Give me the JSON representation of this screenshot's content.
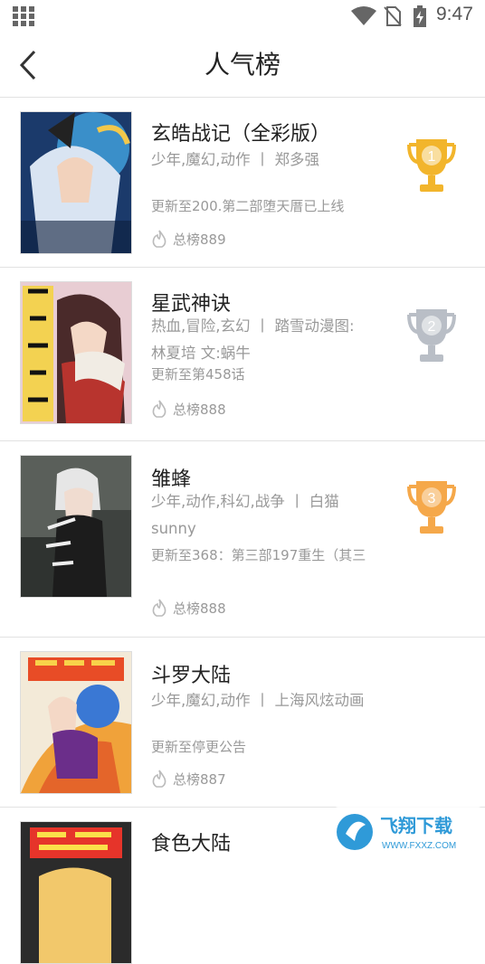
{
  "status_bar": {
    "time": "9:47"
  },
  "header": {
    "title": "人气榜"
  },
  "comics": [
    {
      "title": "玄皓战记（全彩版）",
      "meta": "少年,魔幻,动作 丨 郑多强",
      "update": "更新至200.第二部堕天厝已上线",
      "rank": "总榜889",
      "trophy": "1"
    },
    {
      "title": "星武神诀",
      "meta": "热血,冒险,玄幻 丨 踏雪动漫图:林夏培 文:蜗牛",
      "update": "更新至第458话",
      "rank": "总榜888",
      "trophy": "2"
    },
    {
      "title": "雏蜂",
      "meta": "少年,动作,科幻,战争 丨 白猫sunny",
      "update": "更新至368：第三部197重生（其三",
      "rank": "总榜888",
      "trophy": "3"
    },
    {
      "title": "斗罗大陆",
      "meta": "少年,魔幻,动作 丨 上海风炫动画",
      "update": "更新至停更公告",
      "rank": "总榜887",
      "trophy": ""
    },
    {
      "title": "食色大陆",
      "meta": "",
      "update": "",
      "rank": "",
      "trophy": ""
    }
  ],
  "colors": {
    "gold": "#f2b52c",
    "silver": "#b9bec6",
    "bronze": "#f5a84a"
  },
  "watermark": {
    "text": "飞翔下载",
    "url": "WWW.FXXZ.COM"
  }
}
